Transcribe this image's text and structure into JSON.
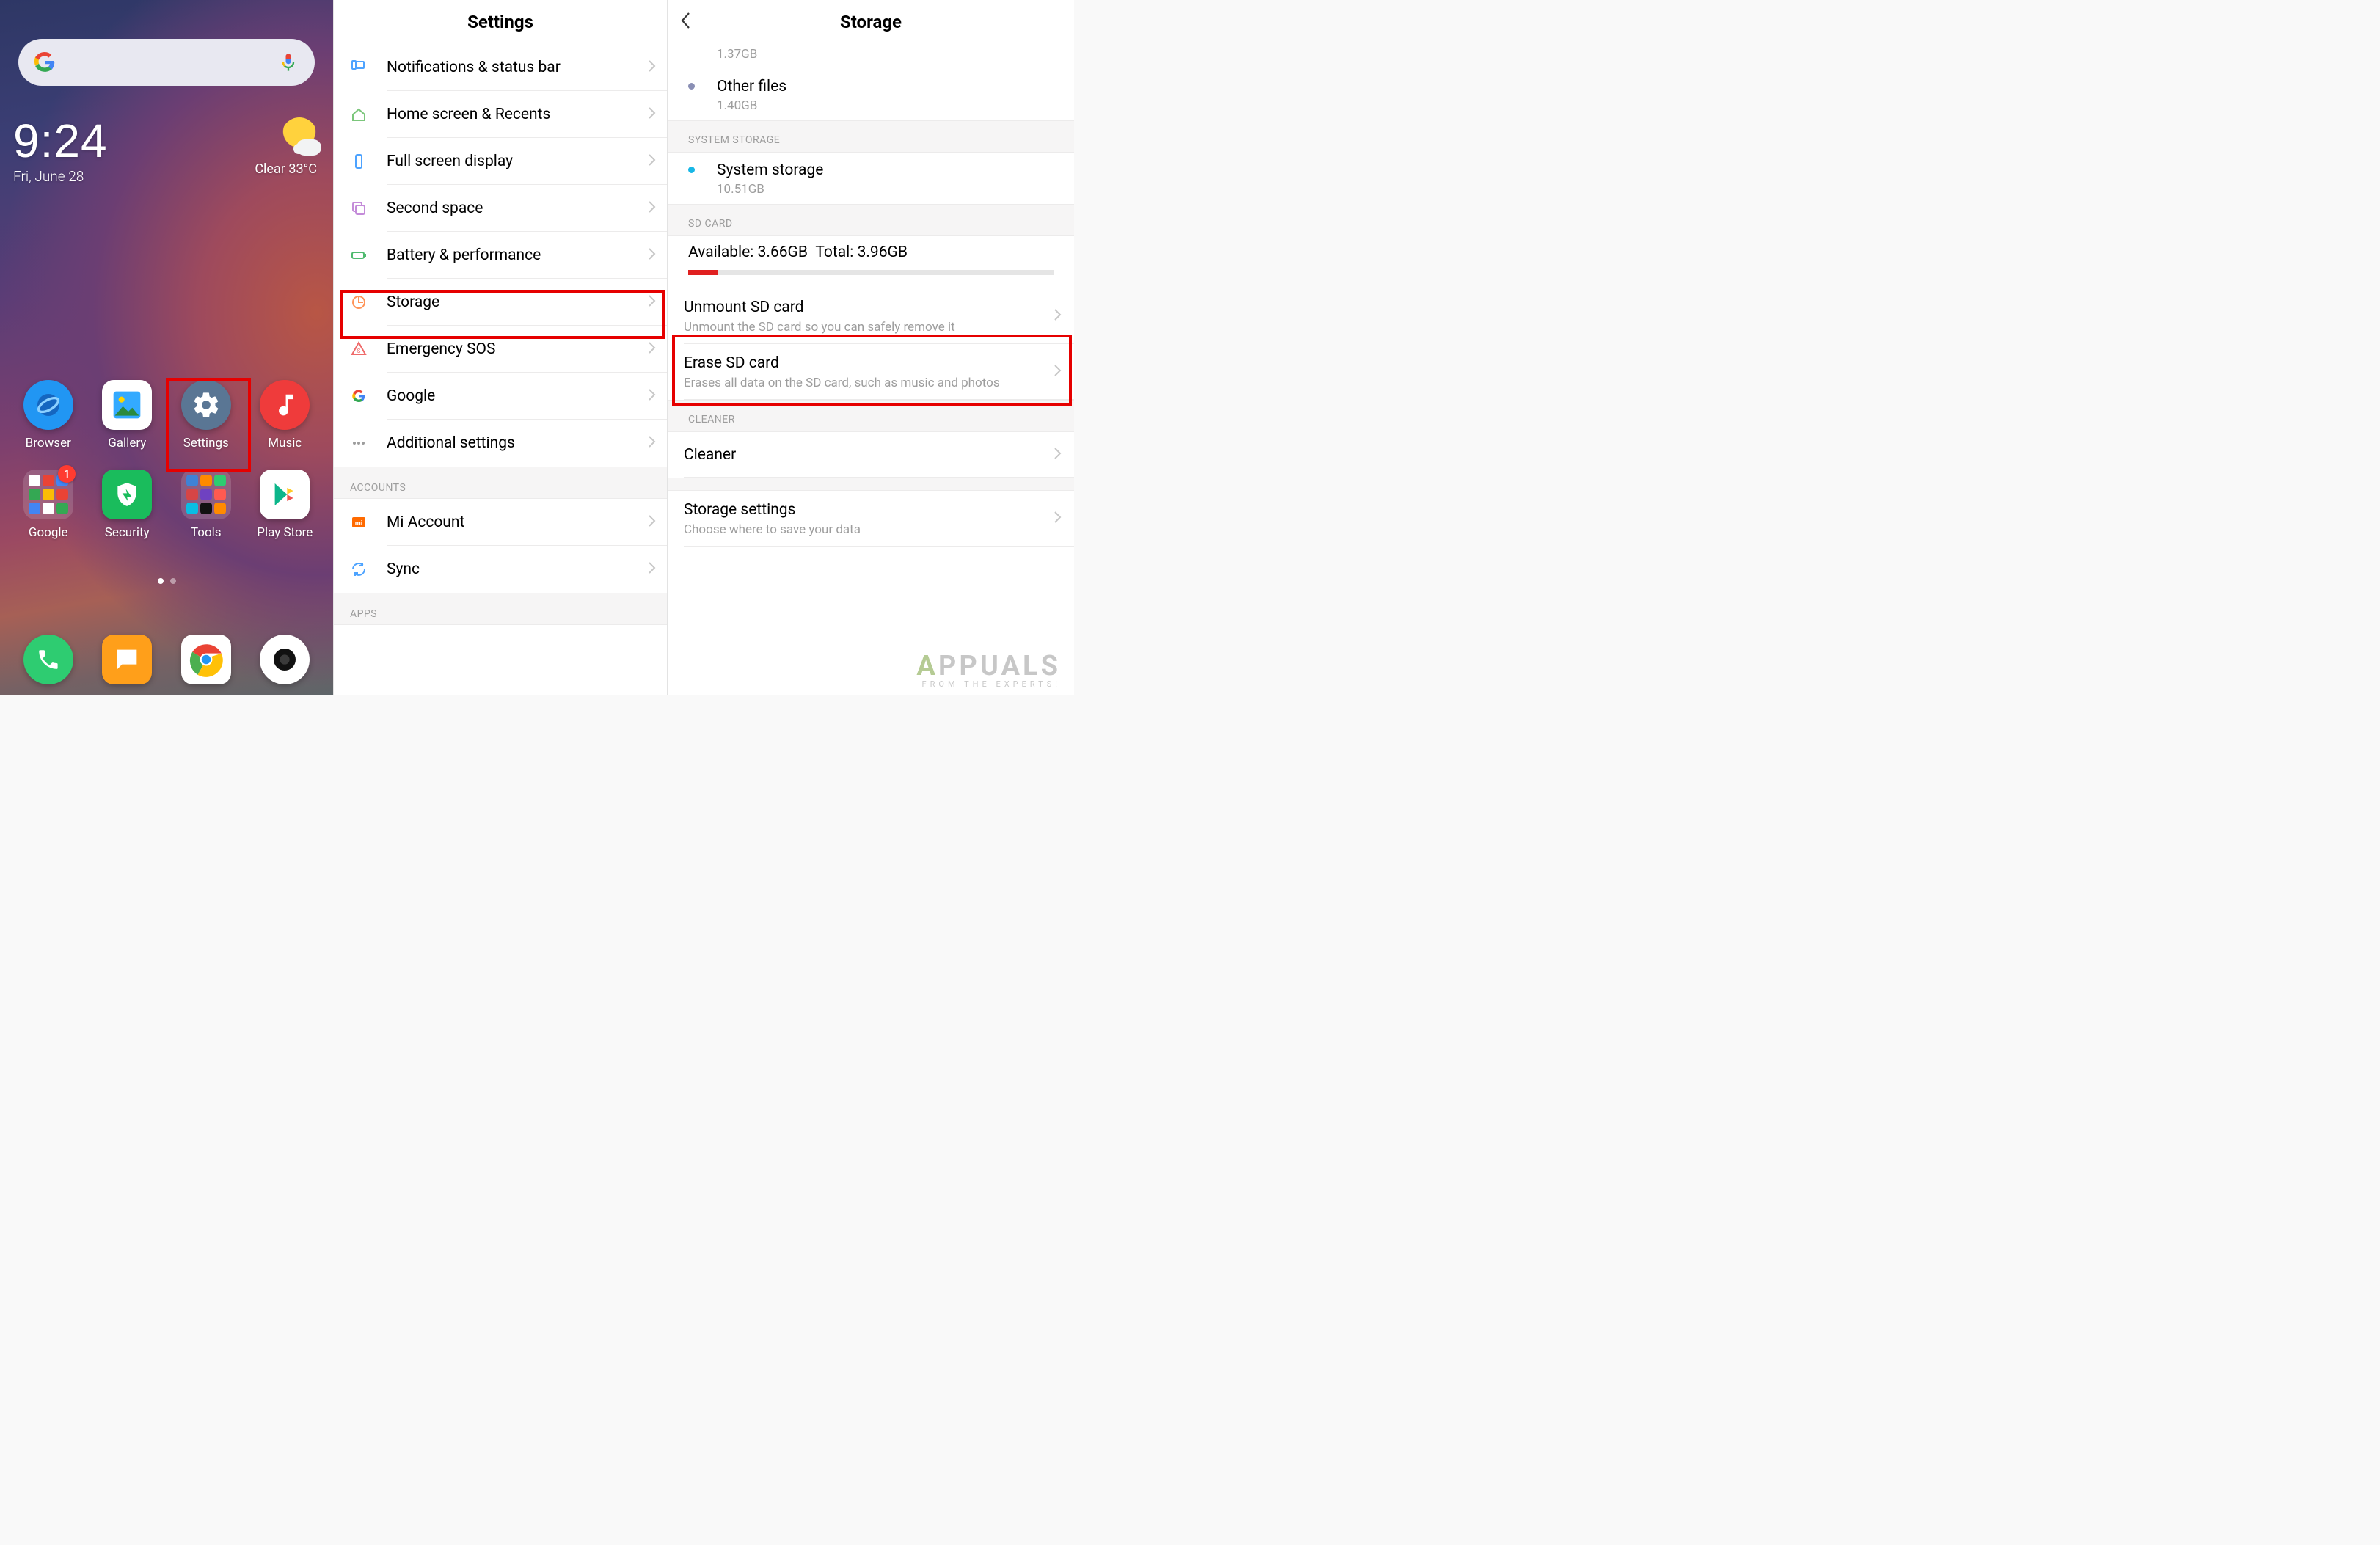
{
  "home": {
    "time": "9:24",
    "date": "Fri, June 28",
    "weather": "Clear  33°C",
    "apps_row1": [
      {
        "label": "Browser"
      },
      {
        "label": "Gallery"
      },
      {
        "label": "Settings"
      },
      {
        "label": "Music"
      }
    ],
    "apps_row2": [
      {
        "label": "Google"
      },
      {
        "label": "Security"
      },
      {
        "label": "Tools"
      },
      {
        "label": "Play Store"
      }
    ],
    "badge": "1"
  },
  "settings": {
    "title": "Settings",
    "items": [
      {
        "label": "Notifications & status bar"
      },
      {
        "label": "Home screen & Recents"
      },
      {
        "label": "Full screen display"
      },
      {
        "label": "Second space"
      },
      {
        "label": "Battery & performance"
      },
      {
        "label": "Storage"
      },
      {
        "label": "Emergency SOS"
      },
      {
        "label": "Google"
      },
      {
        "label": "Additional settings"
      }
    ],
    "section_accounts": "ACCOUNTS",
    "accounts": [
      {
        "label": "Mi Account"
      },
      {
        "label": "Sync"
      }
    ],
    "section_apps": "APPS"
  },
  "storage": {
    "title": "Storage",
    "prev_size": "1.37GB",
    "other_files": {
      "name": "Other files",
      "size": "1.40GB"
    },
    "section_system": "SYSTEM STORAGE",
    "system": {
      "name": "System storage",
      "size": "10.51GB"
    },
    "section_sd": "SD CARD",
    "sd_available_label": "Available:",
    "sd_available_value": "3.66GB",
    "sd_total_label": "Total:",
    "sd_total_value": "3.96GB",
    "sd_fill_pct": 8,
    "unmount": {
      "name": "Unmount SD card",
      "desc": "Unmount the SD card so you can safely remove it"
    },
    "erase": {
      "name": "Erase SD card",
      "desc": "Erases all data on the SD card, such as music and photos"
    },
    "section_cleaner": "CLEANER",
    "cleaner": {
      "name": "Cleaner"
    },
    "storage_settings": {
      "name": "Storage settings",
      "desc": "Choose where to save your data"
    }
  },
  "watermark": {
    "brand_a": "A",
    "brand_b": "PPUALS",
    "tag": "FROM THE EXPERTS!"
  }
}
